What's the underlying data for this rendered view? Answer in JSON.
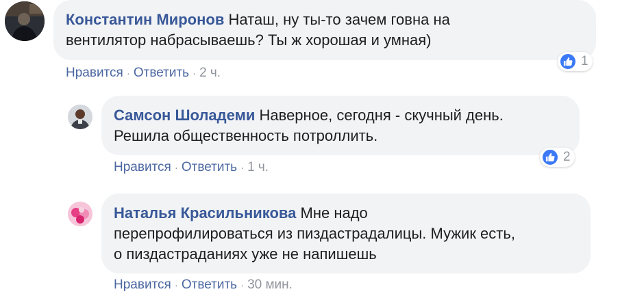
{
  "comments": [
    {
      "author": "Константин Миронов",
      "text_line1": "Наташ, ну ты-то зачем говна на",
      "text_line2": "вентилятор набрасываешь? Ты ж хорошая и умная)",
      "like_label": "Нравится",
      "reply_label": "Ответить",
      "time": "2 ч.",
      "reaction_count": "1",
      "reaction_icon": "like-icon"
    },
    {
      "author": "Самсон Шоладеми",
      "text_line1": "Наверное, сегодня - скучный день.",
      "text_line2": "Решила общественность потроллить.",
      "like_label": "Нравится",
      "reply_label": "Ответить",
      "time": "1 ч.",
      "reaction_count": "2",
      "reaction_icon": "like-icon"
    },
    {
      "author": "Наталья Красильникова",
      "text_line1": "Мне надо",
      "text_line2": "перепрофилироваться из пиздастрадалицы. Мужик есть,",
      "text_line3": "о пиздастраданиях уже не напишешь",
      "like_label": "Нравится",
      "reply_label": "Ответить",
      "time": "30 мин."
    }
  ],
  "colors": {
    "author": "#385898",
    "link": "#4b67a1",
    "muted": "#90949c",
    "bubble": "#f2f3f5",
    "like_blue": "#3b79f6"
  }
}
